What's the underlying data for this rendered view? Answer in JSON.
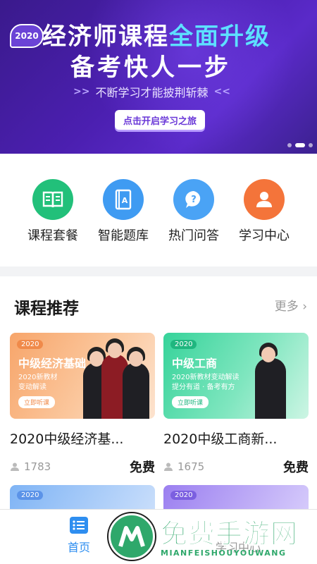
{
  "banner": {
    "badge": "2020",
    "title_part1": "经济师课程",
    "title_part2": "全面升级",
    "title_line2": "备考快人一步",
    "subtitle": "不断学习才能披荆斩棘",
    "cta_label": "点击开启学习之旅",
    "slides_count": 3,
    "active_slide": 2
  },
  "quicknav": {
    "items": [
      {
        "label": "课程套餐",
        "icon": "book-icon",
        "color": "#22c07a"
      },
      {
        "label": "智能题库",
        "icon": "question-bank-icon",
        "color": "#3f9bf2"
      },
      {
        "label": "热门问答",
        "icon": "question-bubble-icon",
        "color": "#4aa3f5"
      },
      {
        "label": "学习中心",
        "icon": "user-icon",
        "color": "#f4743a"
      }
    ]
  },
  "courses": {
    "section_title": "课程推荐",
    "more_label": "更多",
    "items": [
      {
        "thumb_tag": "2020",
        "thumb_title": "中级经济基础",
        "thumb_line1": "2020新教材",
        "thumb_line2": "变动解读",
        "thumb_button": "立即听课",
        "title": "2020中级经济基...",
        "viewers": "1783",
        "price": "免费"
      },
      {
        "thumb_tag": "2020",
        "thumb_title": "中级工商",
        "thumb_line1": "2020新教材变动解读",
        "thumb_line2": "提分有道 · 备考有方",
        "thumb_button": "立即听课",
        "title": "2020中级工商新...",
        "viewers": "1675",
        "price": "免费"
      }
    ],
    "peek_tags": [
      "2020",
      "2020"
    ]
  },
  "tabbar": {
    "tabs": [
      {
        "label": "首页",
        "active": true
      },
      {
        "label": "学习中心",
        "active": false
      }
    ]
  },
  "watermark": {
    "text": "免费手游网",
    "sub": "MIANFEISHOUYOUWANG"
  }
}
